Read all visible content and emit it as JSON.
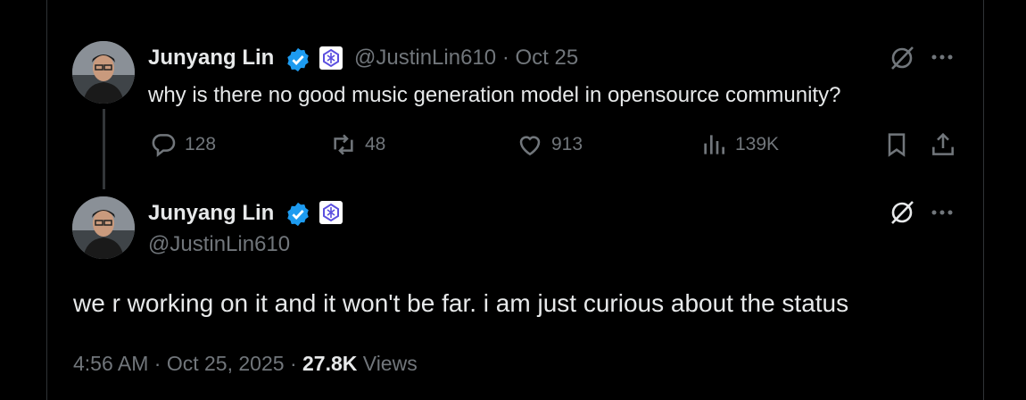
{
  "colors": {
    "background": "#000000",
    "text": "#e7e9ea",
    "muted": "#71767b",
    "verified": "#1d9bf0",
    "divider": "#2f3336"
  },
  "tweet1": {
    "author_name": "Junyang Lin",
    "handle": "@JustinLin610",
    "separator": "·",
    "date": "Oct 25",
    "text": "why is there no good music generation model in opensource community?",
    "replies": "128",
    "reposts": "48",
    "likes": "913",
    "views": "139K",
    "icons": [
      "verified-badge-icon",
      "affiliate-badge-icon",
      "grok-icon",
      "more-icon",
      "reply-icon",
      "repost-icon",
      "like-icon",
      "views-icon",
      "bookmark-icon",
      "share-icon"
    ]
  },
  "tweet2": {
    "author_name": "Junyang Lin",
    "handle": "@JustinLin610",
    "text": "we r working on it and it won't be far. i am just curious about the status",
    "time": "4:56 AM",
    "sep1": "·",
    "date": "Oct 25, 2025",
    "sep2": "·",
    "views_count": "27.8K",
    "views_label": "Views",
    "icons": [
      "verified-badge-icon",
      "affiliate-badge-icon",
      "grok-icon",
      "more-icon"
    ]
  }
}
